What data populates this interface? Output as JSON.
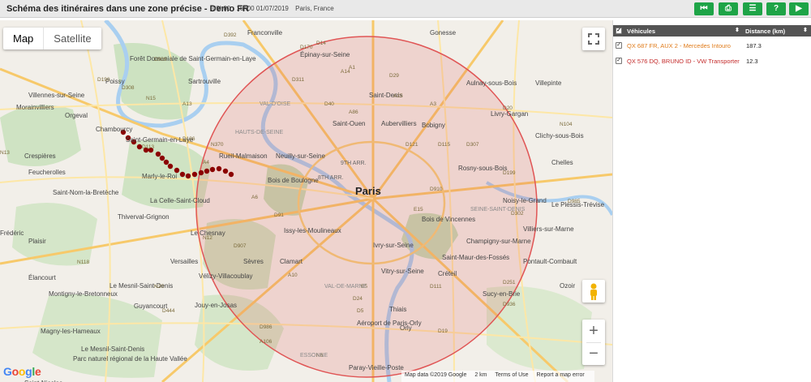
{
  "header": {
    "title": "Schéma des itinéraires dans une zone précise - Demo FR",
    "time_range": "09h00 - 16h00 01/07/2019",
    "location": "Paris, France",
    "buttons": [
      {
        "icon": "skip-back-icon",
        "glyph": "⏮"
      },
      {
        "icon": "print-icon",
        "glyph": "⎙"
      },
      {
        "icon": "list-icon",
        "glyph": "☰"
      },
      {
        "icon": "help-icon",
        "glyph": "?"
      },
      {
        "icon": "play-icon",
        "glyph": "▶"
      }
    ]
  },
  "map": {
    "type_buttons": {
      "map": "Map",
      "satellite": "Satellite"
    },
    "zoom_in": "+",
    "zoom_out": "−",
    "google_logo": "Google",
    "footer": {
      "data": "Map data ©2019 Google",
      "scale": "2 km",
      "terms": "Terms of Use",
      "report": "Report a map error"
    },
    "zone_color": "#e05555",
    "route_color": "#8b0000",
    "labels": {
      "paris": "Paris",
      "districts": [
        "9TH ARR.",
        "8TH ARR."
      ],
      "cities": [
        "Franconville",
        "Gonesse",
        "Épinay-sur-Seine",
        "Saint-Denis",
        "Aulnay-sous-Bois",
        "Sartrouville",
        "Forêt Domaniale de Saint-Germain-en-Laye",
        "Villennes-sur-Seine",
        "Poissy",
        "Morainvilliers",
        "Orgeval",
        "Chambourcy",
        "Saint-Germain-en-Laye",
        "Rueil-Malmaison",
        "Saint-Ouen",
        "Aubervilliers",
        "Bobigny",
        "Livry-Gargan",
        "Villepinte",
        "Clichy-sous-Bois",
        "Neuilly-sur-Seine",
        "Rosny-sous-Bois",
        "Chelles",
        "Marly-le-Roi",
        "Feucherolles",
        "Saint-Nom-la-Bretèche",
        "La Celle-Saint-Cloud",
        "Bois de Boulogne",
        "Noisy-le-Grand",
        "Bois de Vincennes",
        "Thiverval-Grignon",
        "Le Chesnay",
        "Plaisir",
        "Issy-les-Moulineaux",
        "Villiers-sur-Marne",
        "Champigny-sur-Marne",
        "Ivry-sur-Seine",
        "Versailles",
        "Sèvres",
        "Clamart",
        "Saint-Maur-des-Fossés",
        "Pontault-Combault",
        "Élancourt",
        "Vitry-sur-Seine",
        "Créteil",
        "Le Mesnil-Saint-Denis",
        "Vélizy-Villacoublay",
        "Guyancourt",
        "Montigny-le-Bretonneux",
        "Sucy-en-Brie",
        "Jouy-en-Josas",
        "Thiais",
        "Orly",
        "Magny-les-Hameaux",
        "Aéroport de Paris-Orly",
        "Le Mesnil-Saint-Denis",
        "Parc naturel régional de la Haute Vallée",
        "Paray-Vieille-Poste",
        "Saint-Nicolas",
        "Crespières",
        "Frédéric",
        "Le Plessis-Trévise",
        "Ozoir"
      ],
      "roads": [
        "D392",
        "D170",
        "D909",
        "D14",
        "A14",
        "D190",
        "D308",
        "D311",
        "A1",
        "D29",
        "A15",
        "N15",
        "D40",
        "A86",
        "A3",
        "D115",
        "D121",
        "D307",
        "A13",
        "N13",
        "D186",
        "D113",
        "N370",
        "A4",
        "D199",
        "D302",
        "D985",
        "D910",
        "A6",
        "D907",
        "N12",
        "D91",
        "N118",
        "N20",
        "D986",
        "D444",
        "A10",
        "A106",
        "N6",
        "D5",
        "D19",
        "D111",
        "D251",
        "D936",
        "N104",
        "E15",
        "E5",
        "D24",
        "D20"
      ],
      "boundaries": [
        "VAL-D'OISE",
        "HAUTS-DE-SEINE",
        "SEINE-SAINT-DENIS",
        "VAL-DE-MARNE",
        "ESSONNE"
      ]
    }
  },
  "panel": {
    "columns": {
      "vehicles": "Véhicules",
      "distance": "Distance (km)"
    },
    "rows": [
      {
        "vehicle": "QX 687 FR, AUX 2 - Mercedes Intouro",
        "distance": "187.3",
        "color": "#e07b1a",
        "checked": true
      },
      {
        "vehicle": "QX 576 DQ, BRUNO ID - VW Transporter",
        "distance": "12.3",
        "color": "#c42b2b",
        "checked": true
      }
    ]
  }
}
